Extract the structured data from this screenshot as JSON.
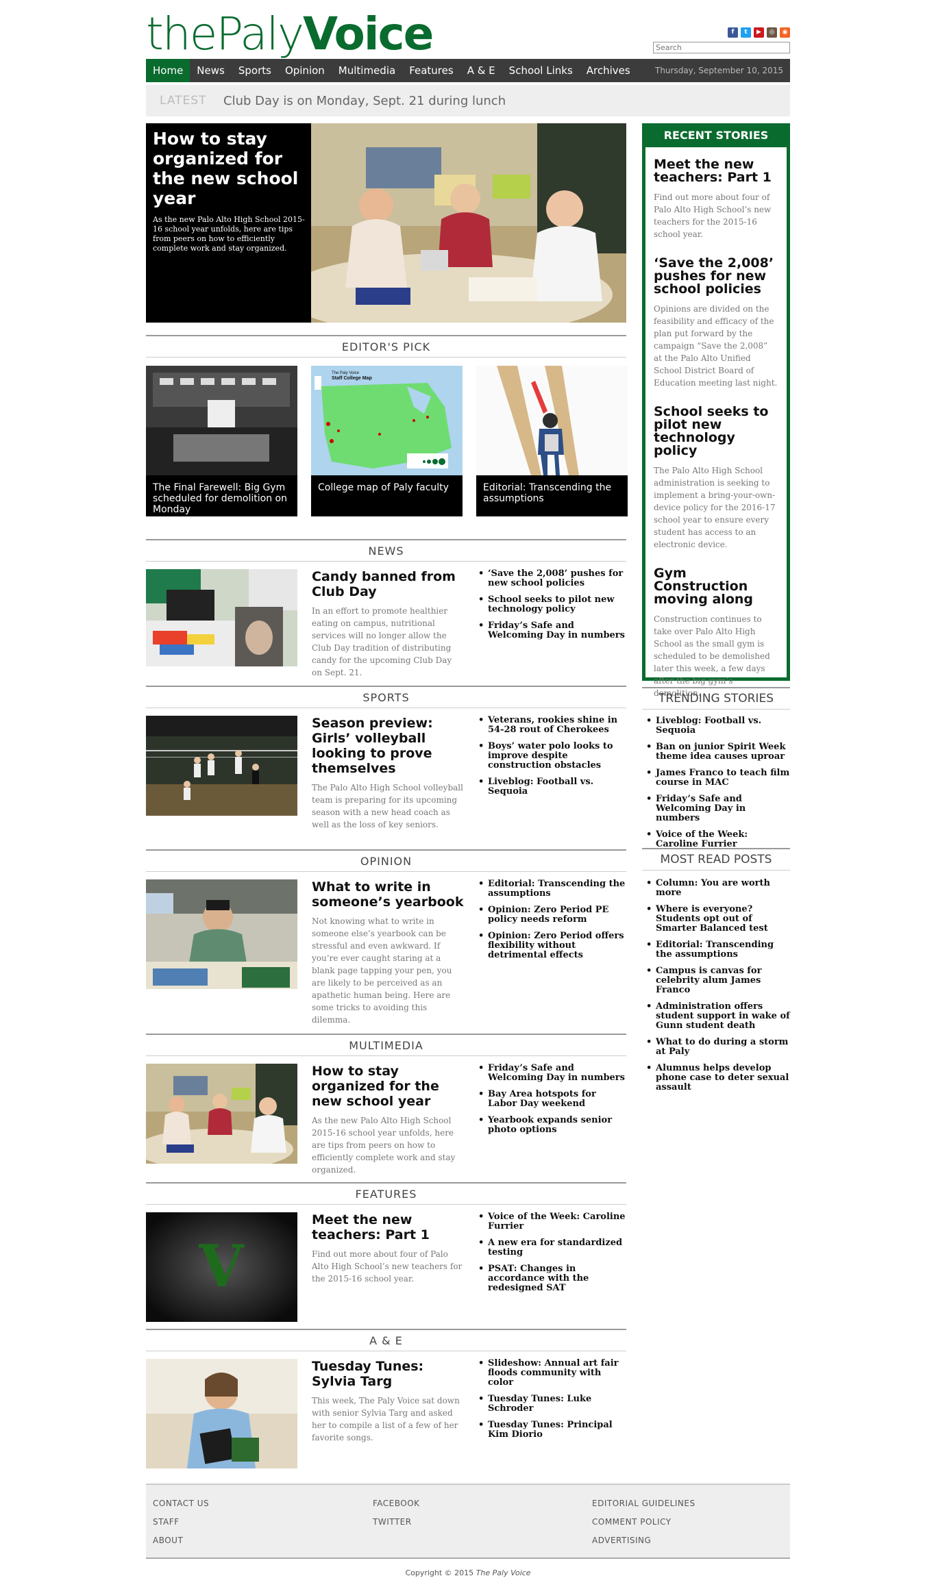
{
  "site": {
    "logo_part1": "the",
    "logo_part2": "Paly",
    "logo_part3": "Voice",
    "search_placeholder": "Search",
    "social_icons": [
      "facebook-icon",
      "twitter-icon",
      "youtube-icon",
      "instagram-icon",
      "rss-icon"
    ]
  },
  "nav": {
    "items": [
      "Home",
      "News",
      "Sports",
      "Opinion",
      "Multimedia",
      "Features",
      "A & E",
      "School Links",
      "Archives"
    ],
    "date": "Thursday, September 10, 2015"
  },
  "latest": {
    "label": "LATEST",
    "text": "Club Day is on Monday, Sept. 21 during lunch"
  },
  "hero": {
    "title": "How to stay organized for the new school year",
    "summary": "As the new Palo Alto High School 2015-16 school year unfolds, here are tips from peers on how to efficiently complete work and stay organized."
  },
  "editors_pick": {
    "heading": "EDITOR'S PICK",
    "items": [
      {
        "caption": "The Final Farewell: Big Gym scheduled for demolition on Monday"
      },
      {
        "caption": "College map of Paly faculty"
      },
      {
        "caption": "Editorial: Transcending the assumptions"
      }
    ],
    "map_title_1": "The Paly Voice",
    "map_title_2": "Staff College Map"
  },
  "sections": {
    "news": {
      "heading": "NEWS",
      "title": "Candy banned from Club Day",
      "summary": "In an effort to promote healthier eating on campus, nutritional services will no longer allow the Club Day tradition of distributing candy for the upcoming Club Day on Sept. 21.",
      "links": [
        "‘Save the 2,008’ pushes for new school policies",
        "School seeks to pilot new technology policy",
        "Friday’s Safe and Welcoming Day in numbers"
      ]
    },
    "sports": {
      "heading": "SPORTS",
      "title": "Season preview: Girls’ volleyball looking to prove themselves",
      "summary": "The Palo Alto High School volleyball team is preparing for its upcoming season with a new head coach as well as the loss of key seniors.",
      "links": [
        "Veterans, rookies shine in 54-28 rout of Cherokees",
        "Boys’ water polo looks to improve despite construction obstacles",
        "Liveblog: Football vs. Sequoia"
      ]
    },
    "opinion": {
      "heading": "OPINION",
      "title": "What to write in someone’s yearbook",
      "summary": "Not knowing what to write in someone else’s yearbook can be stressful and even awkward. If you’re ever caught staring at a blank page tapping your pen, you are likely to be perceived as an apathetic human being. Here are some tricks to avoiding this dilemma.",
      "links": [
        "Editorial: Transcending the assumptions",
        "Opinion: Zero Period PE policy needs reform",
        "Opinion: Zero Period offers flexibility without detrimental effects"
      ]
    },
    "multimedia": {
      "heading": "MULTIMEDIA",
      "title": "How to stay organized for the new school year",
      "summary": "As the new Palo Alto High School 2015-16 school year unfolds, here are tips from peers on how to efficiently complete work and stay organized.",
      "links": [
        "Friday’s Safe and Welcoming Day in numbers",
        "Bay Area hotspots for Labor Day weekend",
        "Yearbook expands senior photo options"
      ]
    },
    "features": {
      "heading": "FEATURES",
      "title": "Meet the new teachers: Part 1",
      "summary": "Find out more about four of Palo Alto High School’s new teachers for the 2015-16 school year.",
      "thumb_letter": "V",
      "links": [
        "Voice of the Week: Caroline Furrier",
        "A new era for standardized testing",
        "PSAT: Changes in accordance with the redesigned SAT"
      ]
    },
    "ae": {
      "heading": "A & E",
      "title": "Tuesday Tunes: Sylvia Targ",
      "summary": "This week, The Paly Voice sat down with senior Sylvia Targ and asked her to compile a list of a few of her favorite songs.",
      "links": [
        "Slideshow: Annual art fair floods community with color",
        "Tuesday Tunes: Luke Schroder",
        "Tuesday Tunes: Principal Kim Diorio"
      ]
    }
  },
  "recent": {
    "heading": "RECENT STORIES",
    "stories": [
      {
        "title": "Meet the new teachers: Part 1",
        "summary": "Find out more about four of Palo Alto High School’s new teachers for the 2015-16 school year."
      },
      {
        "title": "‘Save the 2,008’ pushes for new school policies",
        "summary": "Opinions are divided on the feasibility and efficacy of the plan put forward by the campaign “Save the 2,008” at the Palo Alto Unified School District Board of Education meeting last night."
      },
      {
        "title": "School seeks to pilot new technology policy",
        "summary": "The Palo Alto High School administration is seeking to implement a bring-your-own-device policy for the 2016-17 school year to ensure every student has access to an electronic device."
      },
      {
        "title": "Gym Construction moving along",
        "summary": "Construction continues to take over Palo Alto High School as the small gym is scheduled to be demolished later this week, a few days after the big gym’s demolition."
      }
    ]
  },
  "trending": {
    "heading": "TRENDING STORIES",
    "items": [
      "Liveblog: Football vs. Sequoia",
      "Ban on junior Spirit Week theme idea causes uproar",
      "James Franco to teach film course in MAC",
      "Friday’s Safe and Welcoming Day in numbers",
      "Voice of the Week: Caroline Furrier"
    ]
  },
  "most_read": {
    "heading": "MOST READ POSTS",
    "items": [
      "Column: You are worth more",
      "Where is everyone? Students opt out of Smarter Balanced test",
      "Editorial: Transcending the assumptions",
      "Campus is canvas for celebrity alum James Franco",
      "Administration offers student support in wake of Gunn student death",
      "What to do during a storm at Paly",
      "Alumnus helps develop phone case to deter sexual assault"
    ]
  },
  "footer": {
    "col1": [
      "CONTACT US",
      "STAFF",
      "ABOUT"
    ],
    "col2": [
      "FACEBOOK",
      "TWITTER"
    ],
    "col3": [
      "EDITORIAL GUIDELINES",
      "COMMENT POLICY",
      "ADVERTISING"
    ],
    "copyright_prefix": "Copyright © 2015",
    "copyright_name": "The Paly Voice"
  },
  "colors": {
    "brand_green": "#0a6b2f",
    "nav_bg": "#3c3c3c",
    "latest_bg": "#eeeeee"
  }
}
